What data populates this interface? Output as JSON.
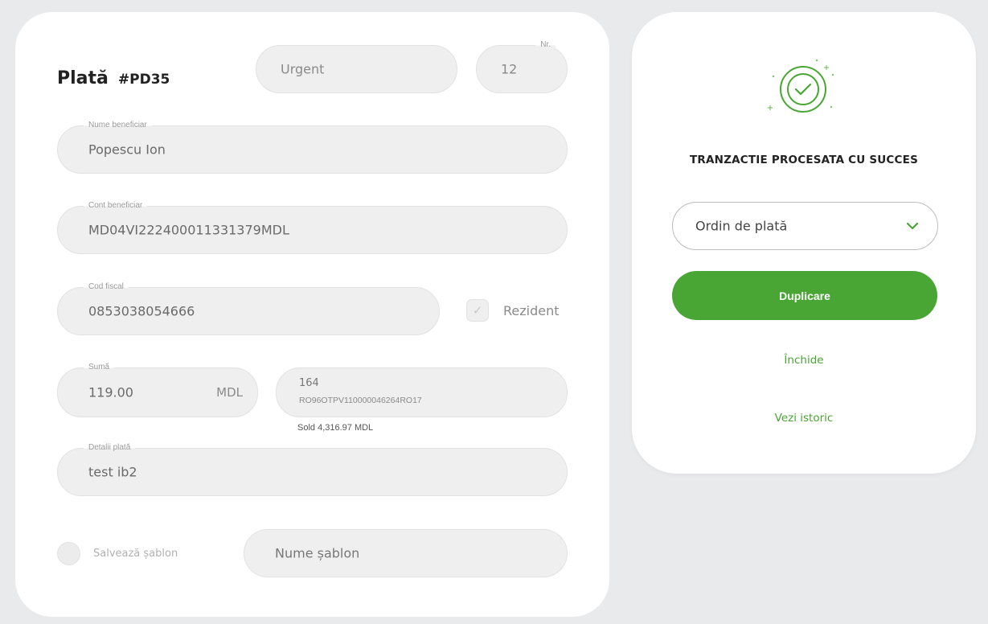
{
  "payment": {
    "title": "Plată",
    "code": "#PD35",
    "urgent_placeholder": "Urgent",
    "nr": {
      "label": "Nr.",
      "value": "12"
    },
    "beneficiary_name": {
      "label": "Nume beneficiar",
      "value": "Popescu Ion"
    },
    "beneficiary_account": {
      "label": "Cont beneficiar",
      "value": "MD04VI222400011331379MDL"
    },
    "fiscal_code": {
      "label": "Cod fiscal",
      "value": "0853038054666"
    },
    "resident": {
      "label": "Rezident",
      "checked": true
    },
    "amount": {
      "label": "Sumă",
      "value": "119.00",
      "currency": "MDL"
    },
    "source_account": {
      "number": "164",
      "iban": "RO96OTPV110000046264RO17"
    },
    "balance": "Sold 4,316.97 MDL",
    "details": {
      "label": "Detalii plată",
      "value": "test ib2"
    },
    "save_template": {
      "label": "Salvează șablon",
      "checked": false
    },
    "template_name_placeholder": "Nume șablon"
  },
  "success": {
    "title": "TRANZACTIE PROCESATA CU SUCCES",
    "document_type": "Ordin de plată",
    "duplicate_button": "Duplicare",
    "close_link": "Închide",
    "history_link": "Vezi istoric"
  },
  "colors": {
    "accent_green": "#49a634",
    "background": "#e9eaec",
    "field_bg": "#efefef"
  },
  "icons": {
    "success": "check-circle-icon",
    "dropdown": "chevron-down-icon",
    "resident_check": "checkmark-icon"
  }
}
